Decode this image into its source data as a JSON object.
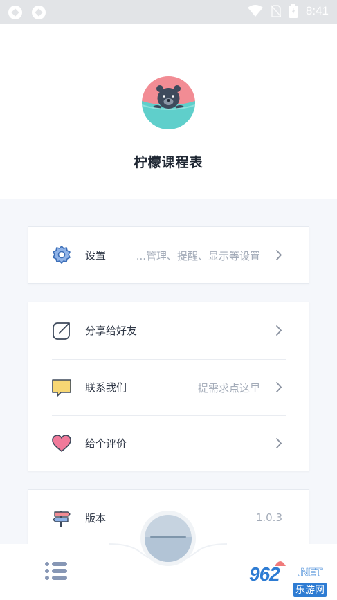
{
  "status_bar": {
    "time": "8:41"
  },
  "app": {
    "name": "柠檬课程表"
  },
  "menu": {
    "settings": {
      "label": "设置",
      "hint": "...管理、提醒、显示等设置"
    },
    "share": {
      "label": "分享给好友"
    },
    "contact": {
      "label": "联系我们",
      "hint": "提需求点这里"
    },
    "rate": {
      "label": "给个评价"
    },
    "version": {
      "label": "版本",
      "value": "1.0.3"
    }
  },
  "watermark": {
    "brand": "962",
    "suffix": ".NET",
    "cn": "乐游网"
  },
  "colors": {
    "accent_blue": "#5b8ed6",
    "heart_pink": "#f07a9a",
    "chat_yellow": "#f7d774",
    "avatar_pink": "#f28c94",
    "avatar_teal": "#5fcfcb"
  }
}
